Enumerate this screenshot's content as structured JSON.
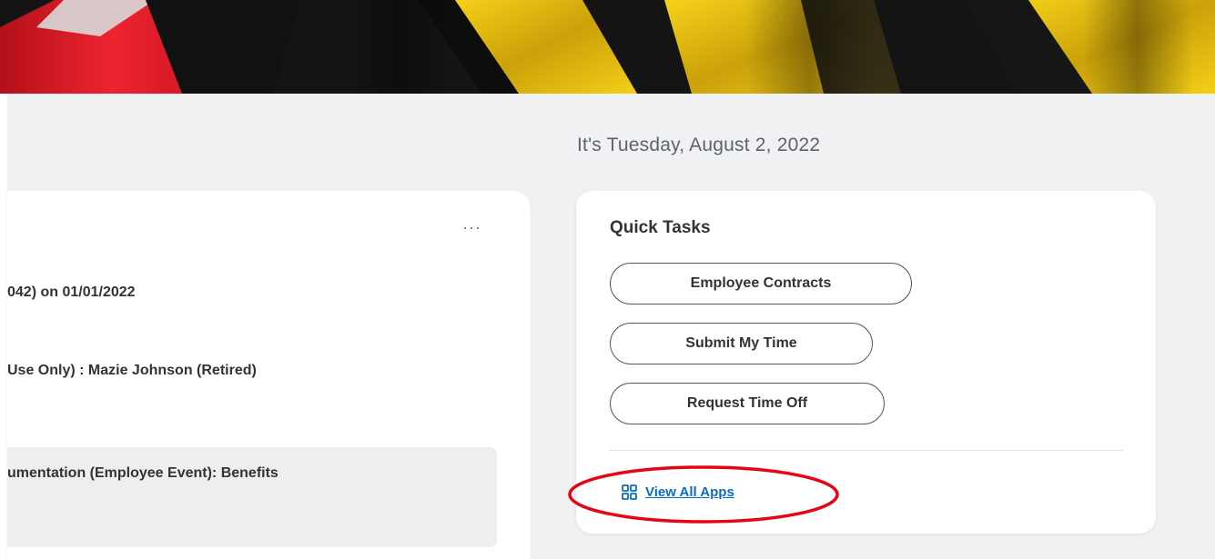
{
  "header": {
    "date_line": "It's Tuesday, August 2, 2022"
  },
  "left_card": {
    "more_label": "···",
    "line1": "042) on 01/01/2022",
    "line2": " Use Only) : Mazie Johnson (Retired)",
    "line3": "umentation (Employee Event): Benefits"
  },
  "quick_tasks": {
    "title": "Quick Tasks",
    "buttons": [
      {
        "label": "Employee Contracts"
      },
      {
        "label": "Submit My Time"
      },
      {
        "label": "Request Time Off"
      }
    ],
    "view_all_label": "View All Apps",
    "view_all_icon": "grid-icon"
  },
  "colors": {
    "banner_red": "#e2202c",
    "banner_yellow": "#f1c40f",
    "banner_black": "#141414",
    "link_blue": "#0a6ebd",
    "annotation_red": "#e30613",
    "page_bg": "#f0f1f2"
  }
}
